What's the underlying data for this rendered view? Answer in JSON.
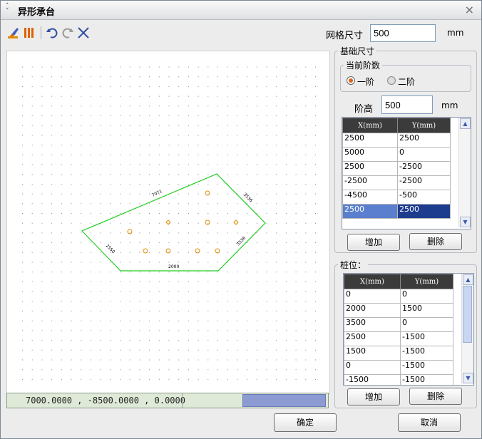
{
  "window": {
    "title": "异形承台",
    "close_glyph": "×"
  },
  "toolbar": {
    "icons": [
      "brush-icon",
      "columns-icon",
      "undo-icon",
      "redo-icon",
      "clear-icon"
    ]
  },
  "grid_size": {
    "label": "网格尺寸",
    "value": "500",
    "unit": "mm"
  },
  "canvas": {
    "edge_labels": [
      "7071",
      "3536",
      "2550",
      "3536",
      "2000"
    ],
    "status_coords": "7000.0000 , -8500.0000 , 0.0000"
  },
  "base": {
    "legend": "基础尺寸",
    "steps": {
      "legend": "当前阶数",
      "options": [
        "一阶",
        "二阶"
      ],
      "selected": 0
    },
    "step_height": {
      "label": "阶高",
      "value": "500",
      "unit": "mm"
    },
    "columns": [
      "X(mm)",
      "Y(mm)"
    ],
    "rows": [
      [
        "2500",
        "2500"
      ],
      [
        "5000",
        "0"
      ],
      [
        "2500",
        "-2500"
      ],
      [
        "-2500",
        "-2500"
      ],
      [
        "-4500",
        "-500"
      ],
      [
        "2500",
        "2500"
      ]
    ],
    "add_label": "增加",
    "delete_label": "删除"
  },
  "piles": {
    "legend": "桩位：",
    "columns": [
      "X(mm)",
      "Y(mm)"
    ],
    "rows": [
      [
        "0",
        "0"
      ],
      [
        "2000",
        "1500"
      ],
      [
        "3500",
        "0"
      ],
      [
        "2500",
        "-1500"
      ],
      [
        "1500",
        "-1500"
      ],
      [
        "0",
        "-1500"
      ],
      [
        "-1500",
        "-1500"
      ]
    ],
    "add_label": "增加",
    "delete_label": "删除"
  },
  "footer": {
    "ok_label": "确定",
    "cancel_label": "取消"
  },
  "colors": {
    "outline": "#22cc22",
    "pile": "#e08a00",
    "selection": "#1c3c8e"
  }
}
